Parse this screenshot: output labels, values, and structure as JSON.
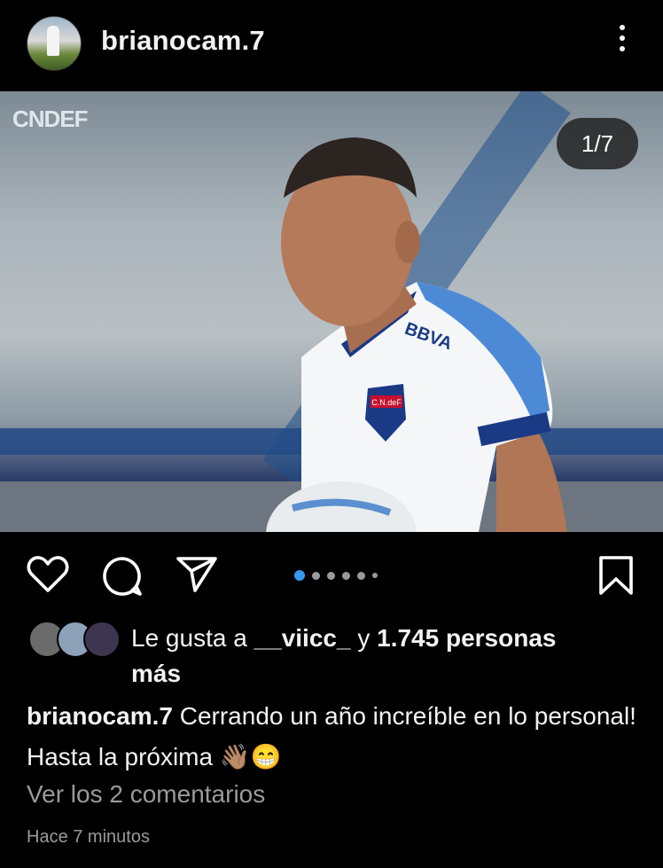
{
  "post": {
    "username": "brianocam.7",
    "image_counter": "1/7",
    "photo_watermark": "CNDEF",
    "shirt_text": "BBVA",
    "crest_text": "C.N.deF"
  },
  "likes": {
    "prefix": "Le gusta a ",
    "liker": "__viicc_",
    "connector": " y ",
    "count_text": "1.745 personas",
    "suffix": "más"
  },
  "caption": {
    "username": "brianocam.7",
    "text": "Cerrando un año increíble en lo personal! Hasta la próxima",
    "emojis": "👋🏽😁"
  },
  "comments_link": "Ver los 2 comentarios",
  "timestamp": "Hace 7 minutos",
  "carousel": {
    "total": 7,
    "current": 1
  },
  "icons": {
    "more": "more-vertical-icon",
    "like": "heart-icon",
    "comment": "comment-icon",
    "share": "send-icon",
    "save": "bookmark-icon"
  },
  "colors": {
    "accent": "#3897f0",
    "background": "#000000",
    "text": "#f2f2f2",
    "muted": "#9a9a9a"
  }
}
